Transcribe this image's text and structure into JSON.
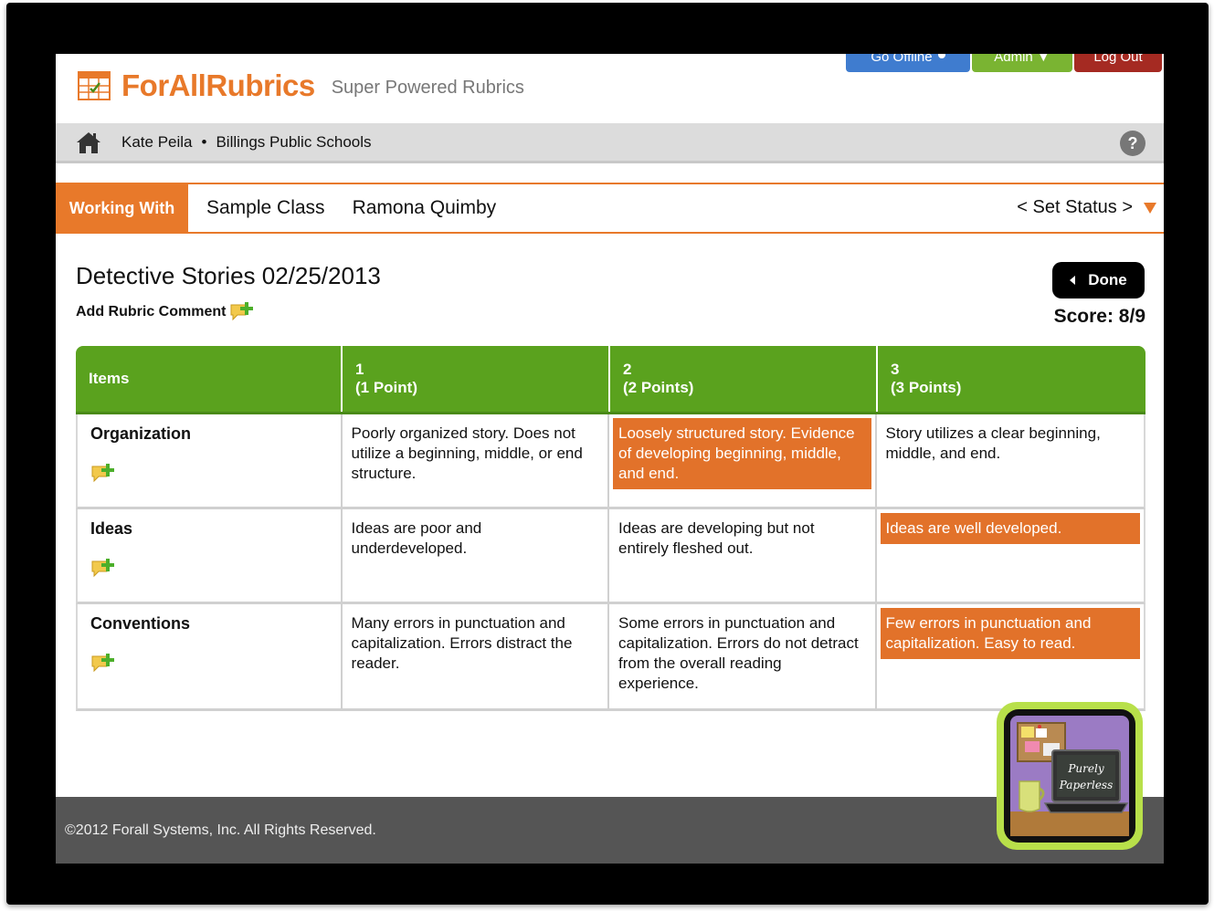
{
  "header": {
    "app_name": "ForAllRubrics",
    "tagline": "Super Powered Rubrics",
    "go_offline": "Go Offline",
    "admin": "Admin ▼",
    "logout": "Log Out"
  },
  "user_bar": {
    "user": "Kate Peila",
    "separator": "•",
    "org": "Billings Public Schools",
    "help": "?"
  },
  "context_bar": {
    "label": "Working With",
    "class_name": "Sample Class",
    "student": "Ramona Quimby",
    "set_status": "< Set Status >"
  },
  "rubric": {
    "title": "Detective Stories  02/25/2013",
    "add_comment": "Add Rubric Comment",
    "done": "Done",
    "score": "Score: 8/9",
    "headers": [
      {
        "line1": "Items",
        "line2": ""
      },
      {
        "line1": "1",
        "line2": "(1 Point)"
      },
      {
        "line1": "2",
        "line2": "(2 Points)"
      },
      {
        "line1": "3",
        "line2": "(3 Points)"
      }
    ],
    "rows": [
      {
        "item": "Organization",
        "levels": [
          "Poorly organized story. Does not utilize a beginning, middle, or end structure.",
          "Loosely structured story. Evidence of developing beginning, middle, and end.",
          "Story utilizes a clear beginning, middle, and end."
        ],
        "selected": 1
      },
      {
        "item": "Ideas",
        "levels": [
          "Ideas are poor and underdeveloped.",
          "Ideas are developing but not entirely fleshed out.",
          "Ideas are well developed."
        ],
        "selected": 2
      },
      {
        "item": "Conventions",
        "levels": [
          "Many errors in punctuation and capitalization. Errors distract the reader.",
          "Some errors in punctuation and capitalization. Errors do not detract from the overall reading experience.",
          "Few errors in punctuation and capitalization. Easy to read."
        ],
        "selected": 2
      }
    ]
  },
  "footer": {
    "copyright": "©2012 Forall Systems, Inc. All Rights Reserved."
  },
  "badge": {
    "line1": "Purely",
    "line2": "Paperless"
  },
  "colors": {
    "brand_orange": "#e8792a",
    "selected_cell": "#e2722a",
    "header_green": "#5aa21e",
    "offline_blue": "#3f7ccf",
    "admin_green": "#7ab432",
    "logout_red": "#a52a22"
  }
}
